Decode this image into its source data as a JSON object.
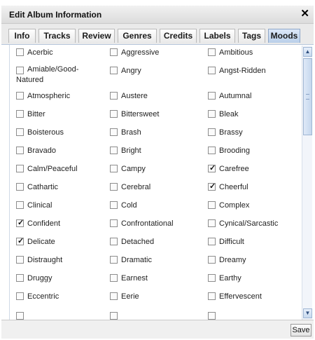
{
  "dialog": {
    "title": "Edit Album Information",
    "close_symbol": "✕"
  },
  "tabs": [
    {
      "label": "Info",
      "active": false
    },
    {
      "label": "Tracks",
      "active": false
    },
    {
      "label": "Review",
      "active": false
    },
    {
      "label": "Genres",
      "active": false
    },
    {
      "label": "Credits",
      "active": false
    },
    {
      "label": "Labels",
      "active": false
    },
    {
      "label": "Tags",
      "active": false
    },
    {
      "label": "Moods",
      "active": true
    }
  ],
  "moods": [
    [
      {
        "label": "Acerbic",
        "checked": false
      },
      {
        "label": "Aggressive",
        "checked": false
      },
      {
        "label": "Ambitious",
        "checked": false
      }
    ],
    [
      {
        "label": "Amiable/Good-Natured",
        "checked": false
      },
      {
        "label": "Angry",
        "checked": false
      },
      {
        "label": "Angst-Ridden",
        "checked": false
      }
    ],
    [
      {
        "label": "Atmospheric",
        "checked": false
      },
      {
        "label": "Austere",
        "checked": false
      },
      {
        "label": "Autumnal",
        "checked": false
      }
    ],
    [
      {
        "label": "Bitter",
        "checked": false
      },
      {
        "label": "Bittersweet",
        "checked": false
      },
      {
        "label": "Bleak",
        "checked": false
      }
    ],
    [
      {
        "label": "Boisterous",
        "checked": false
      },
      {
        "label": "Brash",
        "checked": false
      },
      {
        "label": "Brassy",
        "checked": false
      }
    ],
    [
      {
        "label": "Bravado",
        "checked": false
      },
      {
        "label": "Bright",
        "checked": false
      },
      {
        "label": "Brooding",
        "checked": false
      }
    ],
    [
      {
        "label": "Calm/Peaceful",
        "checked": false
      },
      {
        "label": "Campy",
        "checked": false
      },
      {
        "label": "Carefree",
        "checked": true
      }
    ],
    [
      {
        "label": "Cathartic",
        "checked": false
      },
      {
        "label": "Cerebral",
        "checked": false
      },
      {
        "label": "Cheerful",
        "checked": true
      }
    ],
    [
      {
        "label": "Clinical",
        "checked": false
      },
      {
        "label": "Cold",
        "checked": false
      },
      {
        "label": "Complex",
        "checked": false
      }
    ],
    [
      {
        "label": "Confident",
        "checked": true
      },
      {
        "label": "Confrontational",
        "checked": false
      },
      {
        "label": "Cynical/Sarcastic",
        "checked": false
      }
    ],
    [
      {
        "label": "Delicate",
        "checked": true
      },
      {
        "label": "Detached",
        "checked": false
      },
      {
        "label": "Difficult",
        "checked": false
      }
    ],
    [
      {
        "label": "Distraught",
        "checked": false
      },
      {
        "label": "Dramatic",
        "checked": false
      },
      {
        "label": "Dreamy",
        "checked": false
      }
    ],
    [
      {
        "label": "Druggy",
        "checked": false
      },
      {
        "label": "Earnest",
        "checked": false
      },
      {
        "label": "Earthy",
        "checked": false
      }
    ],
    [
      {
        "label": "Eccentric",
        "checked": false
      },
      {
        "label": "Eerie",
        "checked": false
      },
      {
        "label": "Effervescent",
        "checked": false
      }
    ],
    [
      {
        "label": "",
        "checked": false
      },
      {
        "label": "",
        "checked": false
      },
      {
        "label": "",
        "checked": false
      }
    ]
  ],
  "scrollbar": {
    "up_symbol": "▲",
    "down_symbol": "▼",
    "position": 0.0
  },
  "footer": {
    "save_label": "Save"
  }
}
